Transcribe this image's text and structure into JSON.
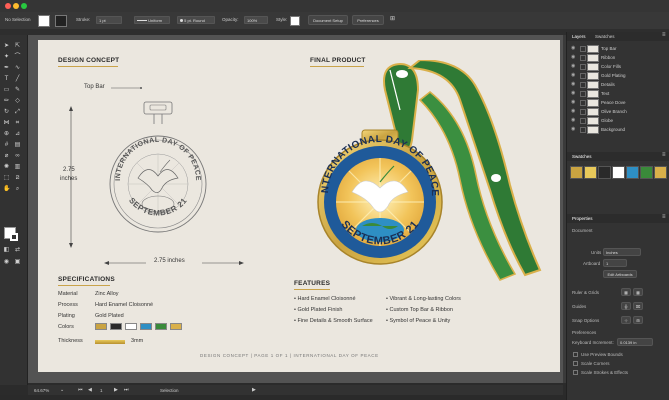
{
  "control_bar": {
    "selection": "No Selection",
    "stroke_label": "Stroke:",
    "stroke_value": "1 pt",
    "profile": "Uniform",
    "brush": "5 pt. Round",
    "opacity_label": "Opacity:",
    "opacity_value": "100%",
    "style_label": "Style:",
    "document_setup": "Document Setup",
    "preferences": "Preferences"
  },
  "artboard": {
    "design_concept": "DESIGN CONCEPT",
    "final_product": "FINAL PRODUCT",
    "top_bar": "Top Bar",
    "height_value": "2.75",
    "height_unit": "inches",
    "width_label": "2.75 inches",
    "medal_top_text": "INTERNATIONAL DAY OF PEACE",
    "medal_bottom_text": "SEPTEMBER 21",
    "specs_title": "SPECIFICATIONS",
    "specs": [
      {
        "key": "Material",
        "value": "Zinc Alloy"
      },
      {
        "key": "Process",
        "value": "Hard Enamel Cloisonné"
      },
      {
        "key": "Plating",
        "value": "Gold Plated"
      },
      {
        "key": "Colors",
        "value": ""
      },
      {
        "key": "Thickness",
        "value": "3mm"
      }
    ],
    "spec_colors": [
      "#c9a341",
      "#2a2a2a",
      "#ffffff",
      "#2e8fc4",
      "#3a8a3a",
      "#d9b04a"
    ],
    "features_title": "FEATURES",
    "features_left": [
      "Hard Enamel Cloisonné",
      "Gold Plated Finish",
      "Fine Details & Smooth Surface"
    ],
    "features_right": [
      "Vibrant & Long-lasting Colors",
      "Custom Top Bar & Ribbon",
      "Symbol of Peace & Unity"
    ],
    "footer": "DESIGN CONCEPT   |   PAGE 1 OF 1   |   INTERNATIONAL DAY OF PEACE"
  },
  "status_bar": {
    "zoom": "64.67%",
    "artboard_num": "1",
    "mode": "Selection"
  },
  "layers_panel": {
    "tab_layers": "Layers",
    "tab_swatches": "Swatches",
    "layers": [
      "Top Bar",
      "Ribbon",
      "Color Fills",
      "Gold Plating",
      "Details",
      "Text",
      "Peace Dove",
      "Olive Branch",
      "Globe",
      "Background"
    ]
  },
  "swatches_panel": {
    "title": "Swatches",
    "colors": [
      "#c9a341",
      "#e8c95a",
      "#2a2a2a",
      "#ffffff",
      "#2e8fc4",
      "#3a8a3a",
      "#d9b04a",
      "#b8902f"
    ]
  },
  "properties_panel": {
    "title": "Properties",
    "section": "Document",
    "units_label": "Units",
    "units_value": "Inches",
    "artboard_label": "Artboard",
    "artboard_value": "1",
    "edit_artboards": "Edit Artboards",
    "rulers_grids": "Ruler & Grids",
    "guides": "Guides",
    "snap_options": "Snap Options",
    "preferences": "Preferences",
    "keyboard_increment_label": "Keyboard Increment:",
    "keyboard_increment_value": "0.0139 in",
    "use_preview_bounds": "Use Preview Bounds",
    "scale_corners": "Scale Corners",
    "scale_strokes": "Scale Strokes & Effects"
  }
}
